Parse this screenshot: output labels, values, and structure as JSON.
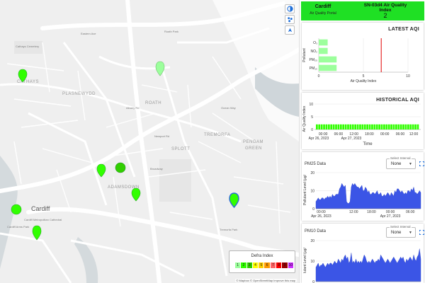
{
  "map": {
    "labels": [
      {
        "text": "PLASNEWYDD",
        "kind": "district"
      },
      {
        "text": "ROATH",
        "kind": "district"
      },
      {
        "text": "ADAMSDOWN",
        "kind": "district"
      },
      {
        "text": "SPLOTT",
        "kind": "district"
      },
      {
        "text": "TREMORFA",
        "kind": "district"
      },
      {
        "text": "PENGAM",
        "kind": "district"
      },
      {
        "text": "GREEN",
        "kind": "district"
      },
      {
        "text": "CATHAYS",
        "kind": "district"
      },
      {
        "text": "Cardiff",
        "kind": "city"
      }
    ],
    "streets": [
      "Eastern Ave",
      "Albany Rd",
      "Newport Rd",
      "Broadway",
      "Cathays Cemetery",
      "Roath Park",
      "Ocean Way",
      "Cardiff Metropolitan Cathedral",
      "Cardiff Arms Park",
      "Tremorfa Park"
    ],
    "controls": [
      "layers-icon",
      "cluster-icon",
      "locate-icon"
    ],
    "legend": {
      "title": "Defra Index",
      "cells": [
        {
          "label": "1",
          "color": "#9cff9c"
        },
        {
          "label": "2",
          "color": "#31ff00"
        },
        {
          "label": "3",
          "color": "#31cf00"
        },
        {
          "label": "4",
          "color": "#ffff00"
        },
        {
          "label": "5",
          "color": "#ffcf00"
        },
        {
          "label": "6",
          "color": "#ff9a00"
        },
        {
          "label": "7",
          "color": "#ff6464"
        },
        {
          "label": "8",
          "color": "#ff0000"
        },
        {
          "label": "9",
          "color": "#990000"
        },
        {
          "label": "10",
          "color": "#ce30ff"
        }
      ]
    },
    "attribution": "© Mapbox © OpenStreetMap Improve this map"
  },
  "header": {
    "city": "Cardiff",
    "subtitle": "Air Quality Portal",
    "station_line1": "SN-03d4 Air Quality",
    "station_line2": "Index",
    "index_value": "2",
    "color": "#1fe024"
  },
  "latest": {
    "title": "LATEST AQI",
    "chart_data": {
      "type": "bar",
      "orientation": "horizontal",
      "categories": [
        "O₃",
        "NO₂",
        "PM₂₅",
        "PM₁₀"
      ],
      "values": [
        1,
        1,
        2,
        2
      ],
      "xlabel": "Air Quality Index",
      "ylabel": "Pollutant",
      "xlim": [
        0,
        10
      ],
      "xticks": [
        0,
        5,
        10
      ],
      "threshold": 7
    }
  },
  "historical": {
    "title": "HISTORICAL AQI",
    "chart_data": {
      "type": "bar",
      "ylabel": "Air Quality Index",
      "xlabel": "Time",
      "ylim": [
        0,
        10
      ],
      "yticks": [
        0,
        5,
        10
      ],
      "xticks": [
        "00:00",
        "06:00",
        "12:00",
        "18:00",
        "00:00",
        "06:00",
        "12:00"
      ],
      "date_labels": [
        "Apr 26, 2023",
        "Apr 27, 2023"
      ],
      "values": [
        2,
        2,
        2,
        2,
        2,
        2,
        2,
        2,
        2,
        2,
        2,
        2,
        2,
        2,
        2,
        2,
        2,
        2,
        2,
        2,
        2,
        2,
        2,
        2,
        2,
        2,
        2,
        2,
        2,
        2,
        2,
        2,
        2,
        2,
        2,
        2,
        2,
        2,
        2,
        2,
        2,
        2,
        2
      ]
    }
  },
  "pm25": {
    "title": "PM25 Data",
    "select_label": "Select Interval",
    "select_value": "None",
    "chart_data": {
      "type": "area",
      "ylabel": "Pollutant Level (µg/",
      "ylim": [
        0,
        20
      ],
      "yticks": [
        0,
        10,
        20
      ],
      "xticks": [
        "00:00",
        "12:00",
        "18:00",
        "00:00",
        "06:00"
      ],
      "date_labels": [
        "Apr 26, 2023",
        "Apr 27, 2023"
      ],
      "values": [
        4,
        5,
        6,
        5,
        5,
        6,
        6,
        5,
        6,
        6,
        7,
        6,
        7,
        6,
        8,
        7,
        7,
        8,
        8,
        8,
        11,
        12,
        14,
        13,
        12,
        13,
        4,
        3,
        3,
        4,
        12,
        14,
        13,
        14,
        13,
        12,
        12,
        11,
        12,
        13,
        10,
        10,
        12,
        11,
        9,
        10,
        8,
        8,
        9,
        9,
        8,
        9,
        10,
        8,
        8,
        9,
        7,
        7,
        8,
        7,
        8,
        9,
        8,
        7,
        9,
        8,
        7,
        10,
        9,
        11,
        11,
        10,
        9,
        10,
        9,
        8,
        9,
        8,
        10,
        10,
        9,
        11,
        10,
        12,
        9,
        9,
        8,
        9,
        10,
        9
      ]
    }
  },
  "pm10": {
    "title": "PM10 Data",
    "select_label": "Select Interval",
    "select_value": "None",
    "chart_data": {
      "type": "area",
      "ylabel": "lutant Level (µg/",
      "ylim": [
        0,
        20
      ],
      "yticks": [
        0,
        10,
        20
      ],
      "values": [
        7,
        8,
        9,
        7,
        8,
        8,
        9,
        8,
        7,
        8,
        9,
        8,
        9,
        9,
        8,
        9,
        10,
        9,
        9,
        11,
        10,
        9,
        11,
        10,
        12,
        13,
        11,
        12,
        9,
        10,
        14,
        9,
        10,
        9,
        11,
        9,
        10,
        9,
        10,
        9,
        11,
        13,
        12,
        10,
        9,
        10,
        9,
        10,
        11,
        10,
        9,
        10,
        10,
        11,
        10,
        13,
        12,
        11,
        10,
        9,
        10,
        11,
        10,
        9,
        10,
        11,
        12,
        11,
        10,
        9,
        10,
        11,
        12,
        11,
        12,
        10,
        9,
        11,
        10,
        11,
        12,
        11,
        10,
        13,
        11,
        10,
        12,
        13,
        16,
        11
      ]
    }
  }
}
